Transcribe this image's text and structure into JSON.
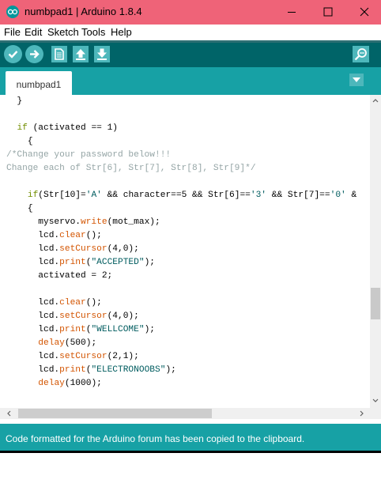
{
  "window": {
    "title": "numbpad1 | Arduino 1.8.4"
  },
  "menu": {
    "items": [
      "File",
      "Edit",
      "Sketch",
      "Tools",
      "Help"
    ]
  },
  "toolbar": {
    "buttons": [
      "check-icon",
      "arrow-right-icon",
      "new-file-icon",
      "upload-arrow-icon",
      "download-arrow-icon"
    ],
    "serial_monitor": "magnifier-icon"
  },
  "tabs": [
    {
      "label": "numbpad1",
      "active": true
    }
  ],
  "editor": {
    "lines": [
      "  }",
      "",
      "  if (activated == 1)",
      "    {",
      "/*Change your password below!!!",
      "Change each of Str[6], Str[7], Str[8], Str[9]*/",
      "",
      "    if(Str[10]='A' && character==5 && Str[6]=='3' && Str[7]=='0' &",
      "    {",
      "      myservo.write(mot_max);",
      "      lcd.clear();",
      "      lcd.setCursor(4,0);",
      "      lcd.print(\"ACCEPTED\");",
      "      activated = 2;",
      "",
      "      lcd.clear();",
      "      lcd.setCursor(4,0);",
      "      lcd.print(\"WELLCOME\");",
      "      delay(500);",
      "      lcd.setCursor(2,1);",
      "      lcd.print(\"ELECTRONOOBS\");",
      "      delay(1000);"
    ]
  },
  "status": {
    "message": "Code formatted for the Arduino forum has been copied to the clipboard."
  },
  "colors": {
    "titlebar": "#ef6378",
    "toolbar": "#006468",
    "tabbar": "#17a1a5",
    "button": "#4db7bb",
    "keyword": "#728e00",
    "function": "#d35400",
    "string": "#005c5f",
    "comment": "#95a5a6"
  }
}
